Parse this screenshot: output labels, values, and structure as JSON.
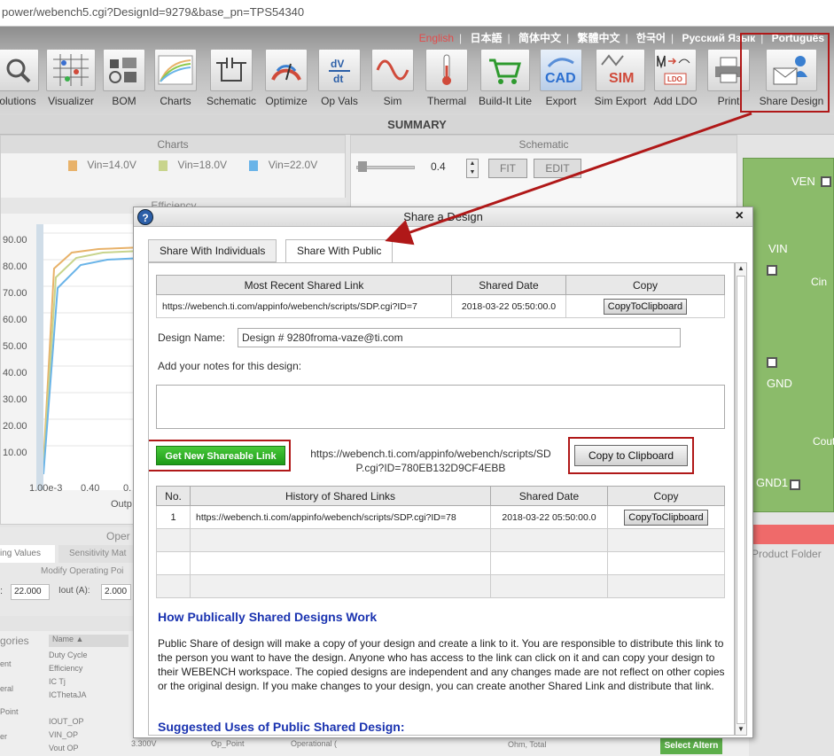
{
  "browser": {
    "url": "power/webench5.cgi?DesignId=9279&base_pn=TPS54340"
  },
  "languages": [
    "English",
    "日本語",
    "简体中文",
    "繁體中文",
    "한국어",
    "Русский Язык",
    "Português"
  ],
  "toolbar": [
    {
      "label": "olutions",
      "icon": "magnifier-icon"
    },
    {
      "label": "Visualizer",
      "icon": "visualizer-grid-icon"
    },
    {
      "label": "BOM",
      "icon": "components-icon"
    },
    {
      "label": "Charts",
      "icon": "chart-icon"
    },
    {
      "label": "Schematic",
      "icon": "schematic-icon"
    },
    {
      "label": "Optimize",
      "icon": "dial-icon"
    },
    {
      "label": "Op Vals",
      "icon": "dvdt-icon"
    },
    {
      "label": "Sim",
      "icon": "sine-wave-icon"
    },
    {
      "label": "Thermal",
      "icon": "thermometer-icon"
    },
    {
      "label": "Build-It Lite",
      "icon": "cart-icon"
    },
    {
      "label": "Export",
      "icon": "cad-icon"
    },
    {
      "label": "Sim Export",
      "icon": "sim-icon"
    },
    {
      "label": "Add LDO",
      "icon": "ldo-icon"
    },
    {
      "label": "Print",
      "icon": "printer-icon"
    },
    {
      "label": "Share Design",
      "icon": "share-design-icon"
    }
  ],
  "summary_title": "SUMMARY",
  "charts_panel": {
    "title": "Charts",
    "legend": [
      "Vin=14.0V",
      "Vin=18.0V",
      "Vin=22.0V"
    ],
    "legend_colors": [
      "#e8b26a",
      "#c8d48c",
      "#6ab4e8"
    ],
    "sub_title": "Efficiency",
    "y_ticks": [
      "90.00",
      "80.00",
      "70.00",
      "60.00",
      "50.00",
      "40.00",
      "30.00",
      "20.00",
      "10.00"
    ],
    "x_ticks": [
      "1.00e-3",
      "0.40",
      "0."
    ],
    "x_label": "Outp"
  },
  "schematic_panel": {
    "title": "Schematic",
    "zoom": "0.4",
    "fit": "FIT",
    "edit": "EDIT"
  },
  "board_labels": [
    "VEN",
    "VIN",
    "Cin",
    "GND",
    "Cout",
    "GND1"
  ],
  "product_folder": "Product Folder",
  "op_panel": {
    "title": "Oper",
    "tabs": [
      "ing Values",
      "Sensitivity Mat"
    ],
    "sub": "Modify Operating Poi",
    "vin_value": "22.000",
    "iout_label": "Iout (A):",
    "iout_value": "2.000"
  },
  "bottom_table": {
    "categories_label": "gories",
    "cats": [
      "ent",
      "eral",
      "Point",
      "er"
    ],
    "name_header": "Name",
    "names": [
      "Duty Cycle",
      "Efficiency",
      "IC Tj",
      "ICThetaJA",
      "IOUT_OP",
      "VIN_OP",
      "Vout OP"
    ],
    "vout_value": "3.300V",
    "vout_cat": "Op_Point",
    "vout_desc": "Operational (",
    "ohm_text": "Ohm, Total",
    "select_alt": "Select Altern"
  },
  "dialog": {
    "title": "Share a Design",
    "close": "×",
    "help": "?",
    "tabs": [
      "Share With Individuals",
      "Share With Public"
    ],
    "recent": {
      "headers": [
        "Most Recent Shared Link",
        "Shared Date",
        "Copy"
      ],
      "link": "https://webench.ti.com/appinfo/webench/scripts/SDP.cgi?ID=7",
      "date": "2018-03-22 05:50:00.0",
      "copy_btn": "CopyToClipboard"
    },
    "design_name_label": "Design Name:",
    "design_name_value": "Design # 9280froma-vaze@ti.com",
    "notes_label": "Add your notes for this design:",
    "get_link_btn": "Get New Shareable Link",
    "new_link_line1": "https://webench.ti.com/appinfo/webench/scripts/SD",
    "new_link_line2": "P.cgi?ID=780EB132D9CF4EBB",
    "copy_clip_btn": "Copy to Clipboard",
    "history": {
      "headers": [
        "No.",
        "History of Shared Links",
        "Shared Date",
        "Copy"
      ],
      "rows": [
        {
          "no": "1",
          "link": "https://webench.ti.com/appinfo/webench/scripts/SDP.cgi?ID=78",
          "date": "2018-03-22 05:50:00.0",
          "copy": "CopyToClipboard"
        }
      ]
    },
    "how_title": "How Publically Shared Designs Work",
    "how_text": "Public Share of design will make a copy of your design and create a link to it. You are responsible to distribute this link to the person you want to have the design. Anyone who has access to the link can click on it and can copy your design to their WEBENCH workspace. The copied designs are independent and any changes made are not reflect on other copies or the original design. If you make changes to your design, you can create another Shared Link and distribute that link.",
    "suggested_title": "Suggested Uses of Public Shared Design:"
  },
  "colors": {
    "accent_red": "#b01818",
    "green_button": "#1e9b18",
    "link_blue": "#1a33b0"
  }
}
